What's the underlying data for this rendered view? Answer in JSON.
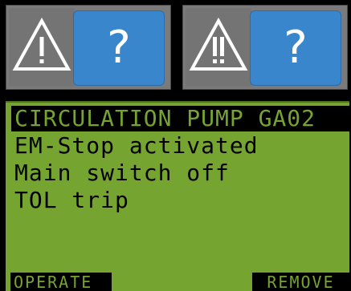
{
  "header": {
    "panel_a": {
      "warning_icon": "warning-triangle-exclamation-icon",
      "help_label": "?"
    },
    "panel_b": {
      "warning_icon": "warning-triangle-double-exclamation-icon",
      "help_label": "?"
    }
  },
  "display": {
    "title": "CIRCULATION PUMP GA02",
    "messages": [
      "EM-Stop activated",
      "Main switch off",
      "TOL trip"
    ],
    "softkeys": {
      "left": "OPERATE",
      "right": "REMOVE"
    }
  },
  "colors": {
    "lcd_green": "#76a431",
    "help_blue": "#3a86cc",
    "panel_gray": "#7a7a7a"
  }
}
